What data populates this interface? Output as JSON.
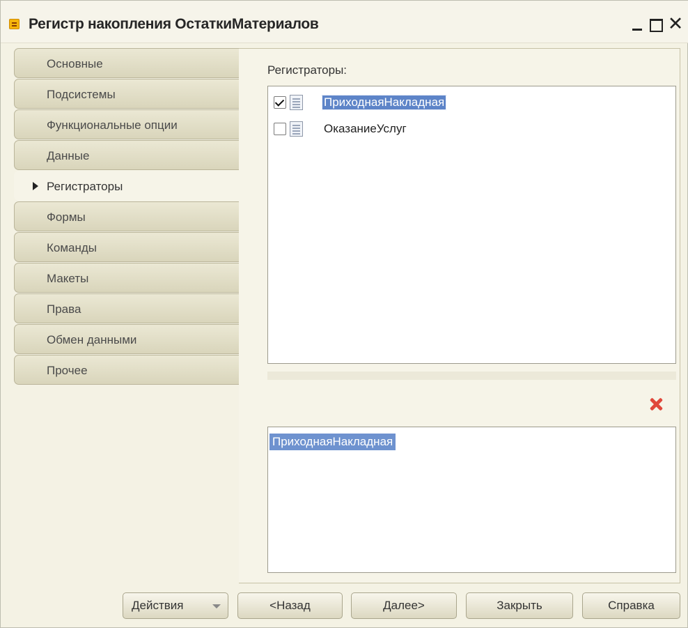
{
  "window": {
    "title": "Регистр накопления ОстаткиМатериалов",
    "close_glyph": "✕"
  },
  "tabs": [
    {
      "label": "Основные",
      "active": false
    },
    {
      "label": "Подсистемы",
      "active": false
    },
    {
      "label": "Функциональные опции",
      "active": false
    },
    {
      "label": "Данные",
      "active": false
    },
    {
      "label": "Регистраторы",
      "active": true
    },
    {
      "label": "Формы",
      "active": false
    },
    {
      "label": "Команды",
      "active": false
    },
    {
      "label": "Макеты",
      "active": false
    },
    {
      "label": "Права",
      "active": false
    },
    {
      "label": "Обмен данными",
      "active": false
    },
    {
      "label": "Прочее",
      "active": false
    }
  ],
  "registrators": {
    "label": "Регистраторы:",
    "items": [
      {
        "name": "ПриходнаяНакладная",
        "checked": true,
        "selected": true
      },
      {
        "name": "ОказаниеУслуг",
        "checked": false,
        "selected": false
      }
    ]
  },
  "selected_list": {
    "items": [
      "ПриходнаяНакладная"
    ]
  },
  "buttons": {
    "actions": "Действия",
    "back": "<Назад",
    "next": "Далее>",
    "close": "Закрыть",
    "help": "Справка"
  },
  "colors": {
    "selection": "#5d84c8",
    "delete_icon": "#e0473a",
    "window_bg": "#f4f2e4"
  }
}
